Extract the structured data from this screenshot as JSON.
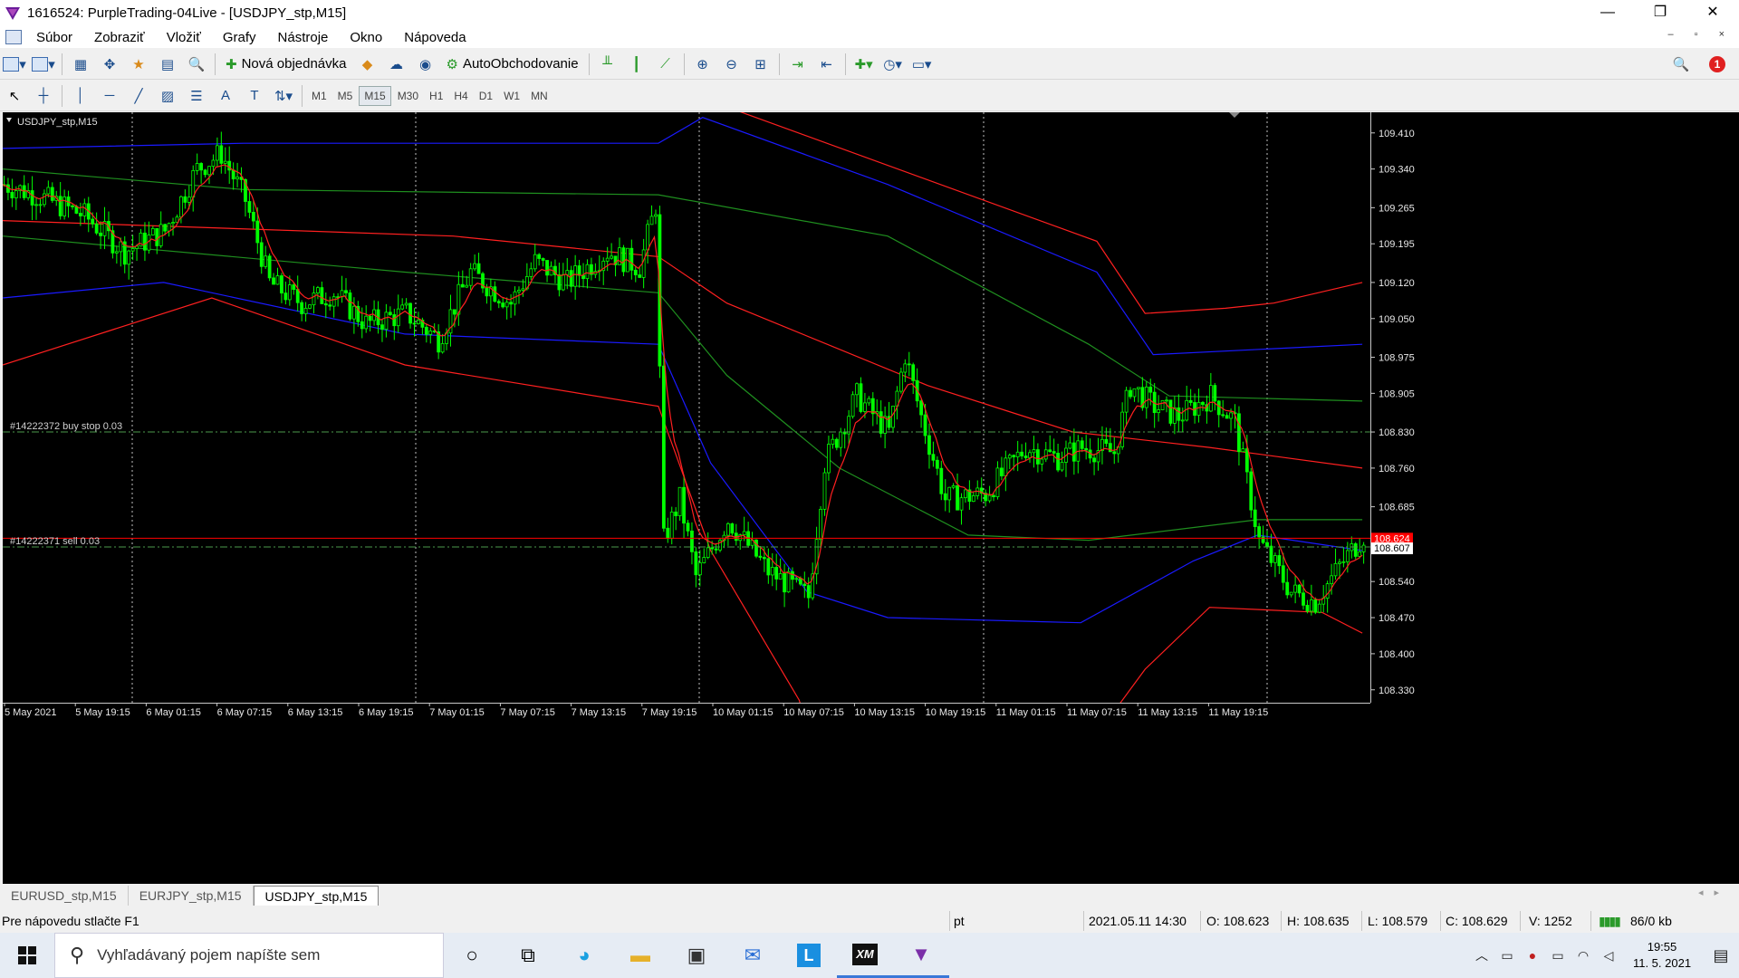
{
  "window": {
    "title": "1616524: PurpleTrading-04Live - [USDJPY_stp,M15]",
    "minimize": "—",
    "maximize": "❐",
    "close": "✕"
  },
  "menu": [
    "Súbor",
    "Zobraziť",
    "Vložiť",
    "Grafy",
    "Nástroje",
    "Okno",
    "Nápoveda"
  ],
  "mdi_controls": "– ▫ ×",
  "toolbar": {
    "new_order": "Nová objednávka",
    "auto_trading": "AutoObchodovanie",
    "notification_count": "1"
  },
  "timeframes": [
    "M1",
    "M5",
    "M15",
    "M30",
    "H1",
    "H4",
    "D1",
    "W1",
    "MN"
  ],
  "active_timeframe": "M15",
  "chart": {
    "label": "USDJPY_stp,M15",
    "price_ticks": [
      "109.410",
      "109.340",
      "109.265",
      "109.195",
      "109.120",
      "109.050",
      "108.975",
      "108.905",
      "108.830",
      "108.760",
      "108.685",
      "108.540",
      "108.470",
      "108.400",
      "108.330"
    ],
    "time_ticks": [
      "5 May 2021",
      "5 May 19:15",
      "6 May 01:15",
      "6 May 07:15",
      "6 May 13:15",
      "6 May 19:15",
      "7 May 01:15",
      "7 May 07:15",
      "7 May 13:15",
      "7 May 19:15",
      "10 May 01:15",
      "10 May 07:15",
      "10 May 13:15",
      "10 May 19:15",
      "11 May 01:15",
      "11 May 07:15",
      "11 May 13:15",
      "11 May 19:15"
    ],
    "order_buy_stop": {
      "label": "#14222372 buy stop 0.03",
      "price": 108.83
    },
    "order_sell": {
      "label": "#14222371 sell 0.03",
      "price": 108.607
    },
    "ask_price": "108.624",
    "bid_price": "108.607",
    "colors": {
      "candles": "#00ff00",
      "background": "#000000",
      "ask_line": "#ff0000",
      "ma_red": "#ff2020",
      "ma_blue": "#1a1aff",
      "ma_green": "#1f8f1f"
    }
  },
  "chart_data": {
    "type": "candlestick",
    "symbol": "USDJPY_stp",
    "timeframe": "M15",
    "ylim": [
      108.305,
      109.45
    ],
    "close_series": [
      [
        0,
        109.31
      ],
      [
        40,
        109.29
      ],
      [
        100,
        109.25
      ],
      [
        150,
        109.18
      ],
      [
        200,
        109.22
      ],
      [
        240,
        109.34
      ],
      [
        270,
        109.37
      ],
      [
        300,
        109.28
      ],
      [
        330,
        109.12
      ],
      [
        370,
        109.08
      ],
      [
        410,
        109.1
      ],
      [
        450,
        109.04
      ],
      [
        500,
        109.06
      ],
      [
        540,
        109.01
      ],
      [
        580,
        109.14
      ],
      [
        630,
        109.08
      ],
      [
        660,
        109.16
      ],
      [
        700,
        109.12
      ],
      [
        750,
        109.18
      ],
      [
        790,
        109.15
      ],
      [
        810,
        109.27
      ],
      [
        820,
        108.62
      ],
      [
        840,
        108.7
      ],
      [
        860,
        108.55
      ],
      [
        900,
        108.66
      ],
      [
        950,
        108.56
      ],
      [
        1000,
        108.51
      ],
      [
        1020,
        108.77
      ],
      [
        1060,
        108.9
      ],
      [
        1100,
        108.83
      ],
      [
        1120,
        108.98
      ],
      [
        1140,
        108.86
      ],
      [
        1170,
        108.7
      ],
      [
        1220,
        108.71
      ],
      [
        1270,
        108.8
      ],
      [
        1310,
        108.78
      ],
      [
        1340,
        108.8
      ],
      [
        1380,
        108.79
      ],
      [
        1400,
        108.92
      ],
      [
        1430,
        108.88
      ],
      [
        1460,
        108.86
      ],
      [
        1500,
        108.9
      ],
      [
        1530,
        108.85
      ],
      [
        1560,
        108.62
      ],
      [
        1600,
        108.52
      ],
      [
        1630,
        108.5
      ],
      [
        1660,
        108.57
      ],
      [
        1690,
        108.63
      ]
    ],
    "series": [
      {
        "color": "#ff2020",
        "values": [
          [
            0,
            109.46
          ],
          [
            815,
            109.46
          ],
          [
            830,
            109.5
          ],
          [
            1360,
            109.2
          ],
          [
            1420,
            109.06
          ],
          [
            1520,
            109.07
          ],
          [
            1580,
            109.08
          ],
          [
            1690,
            109.12
          ]
        ]
      },
      {
        "color": "#1a1aff",
        "values": [
          [
            0,
            109.38
          ],
          [
            300,
            109.39
          ],
          [
            815,
            109.39
          ],
          [
            870,
            109.44
          ],
          [
            1100,
            109.31
          ],
          [
            1360,
            109.14
          ],
          [
            1430,
            108.98
          ],
          [
            1690,
            109.0
          ]
        ]
      },
      {
        "color": "#1f8f1f",
        "values": [
          [
            0,
            109.34
          ],
          [
            300,
            109.3
          ],
          [
            815,
            109.29
          ],
          [
            1100,
            109.21
          ],
          [
            1350,
            109.0
          ],
          [
            1450,
            108.9
          ],
          [
            1690,
            108.89
          ]
        ]
      },
      {
        "color": "#ff2020",
        "values": [
          [
            0,
            109.24
          ],
          [
            560,
            109.21
          ],
          [
            815,
            109.17
          ],
          [
            900,
            109.08
          ],
          [
            1150,
            108.92
          ],
          [
            1330,
            108.83
          ],
          [
            1500,
            108.8
          ],
          [
            1690,
            108.76
          ]
        ]
      },
      {
        "color": "#1f8f1f",
        "values": [
          [
            0,
            109.21
          ],
          [
            500,
            109.14
          ],
          [
            815,
            109.1
          ],
          [
            900,
            108.94
          ],
          [
            1040,
            108.76
          ],
          [
            1200,
            108.63
          ],
          [
            1350,
            108.62
          ],
          [
            1560,
            108.66
          ],
          [
            1690,
            108.66
          ]
        ]
      },
      {
        "color": "#1a1aff",
        "values": [
          [
            0,
            109.09
          ],
          [
            200,
            109.12
          ],
          [
            500,
            109.02
          ],
          [
            815,
            109.0
          ],
          [
            880,
            108.77
          ],
          [
            1000,
            108.52
          ],
          [
            1100,
            108.47
          ],
          [
            1340,
            108.46
          ],
          [
            1480,
            108.58
          ],
          [
            1560,
            108.63
          ],
          [
            1690,
            108.6
          ]
        ]
      },
      {
        "color": "#ff2020",
        "values": [
          [
            0,
            108.96
          ],
          [
            260,
            109.09
          ],
          [
            500,
            108.96
          ],
          [
            815,
            108.88
          ],
          [
            880,
            108.6
          ],
          [
            990,
            108.31
          ],
          [
            1010,
            108.2
          ],
          [
            1340,
            108.2
          ],
          [
            1420,
            108.37
          ],
          [
            1500,
            108.49
          ],
          [
            1640,
            108.48
          ],
          [
            1690,
            108.44
          ]
        ]
      }
    ]
  },
  "tabs": [
    "EURUSD_stp,M15",
    "EURJPY_stp,M15",
    "USDJPY_stp,M15"
  ],
  "active_tab": "USDJPY_stp,M15",
  "status": {
    "help": "Pre nápovedu stlačte F1",
    "profile": "pt",
    "datetime": "2021.05.11 14:30",
    "open": "O: 108.623",
    "high": "H: 108.635",
    "low": "L: 108.579",
    "close": "C: 108.629",
    "volume": "V: 1252",
    "traffic": "86/0 kb"
  },
  "taskbar": {
    "search_placeholder": "Vyhľadávaný pojem napíšte sem",
    "time": "19:55",
    "date": "11. 5. 2021"
  }
}
